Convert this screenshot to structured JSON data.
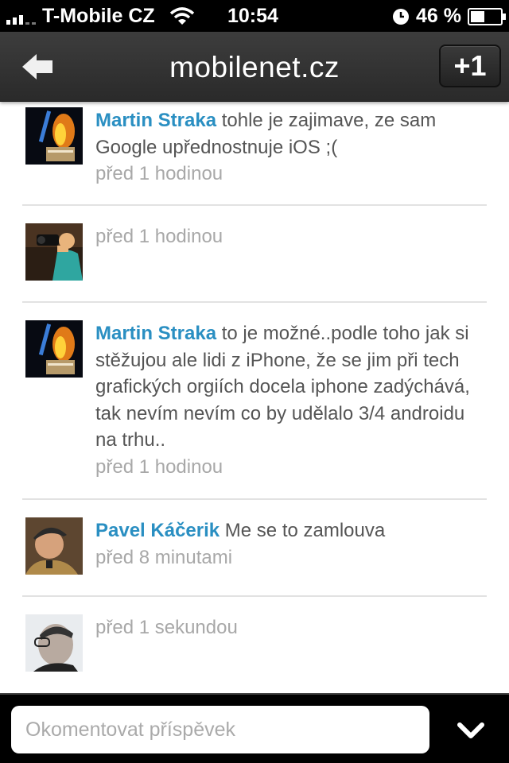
{
  "status_bar": {
    "carrier": "T-Mobile CZ",
    "time": "10:54",
    "battery": "46 %",
    "battery_level": 0.46
  },
  "nav": {
    "title": "mobilenet.cz",
    "plus_one_label": "+1",
    "back_icon": "back-arrow-icon"
  },
  "comments": [
    {
      "author": "Martin Straka",
      "text": "tohle je zajimave, ze sam Google upřednostnuje iOS ;(",
      "time": "před 1 hodinou",
      "avatar": "blue-flame-avatar"
    },
    {
      "author": "",
      "text": "",
      "time": "před 1 hodinou",
      "avatar": "photographer-avatar"
    },
    {
      "author": "Martin Straka",
      "text": "to je možné..podle toho jak si stěžujou ale lidi z iPhone, že se jim při tech grafických orgiích docela iphone zadýchává, tak nevím nevím co by udělalo 3/4 androidu na trhu..",
      "time": "před 1 hodinou",
      "avatar": "blue-flame-avatar"
    },
    {
      "author": "Pavel Káčerik",
      "text": "Me se to zamlouva",
      "time": "před 8 minutami",
      "avatar": "cap-man-avatar"
    },
    {
      "author": "",
      "text": "",
      "time": "před 1 sekundou",
      "avatar": "glasses-man-avatar"
    }
  ],
  "composer": {
    "placeholder": "Okomentovat příspěvek",
    "value": "",
    "collapse_icon": "chevron-down-icon"
  }
}
